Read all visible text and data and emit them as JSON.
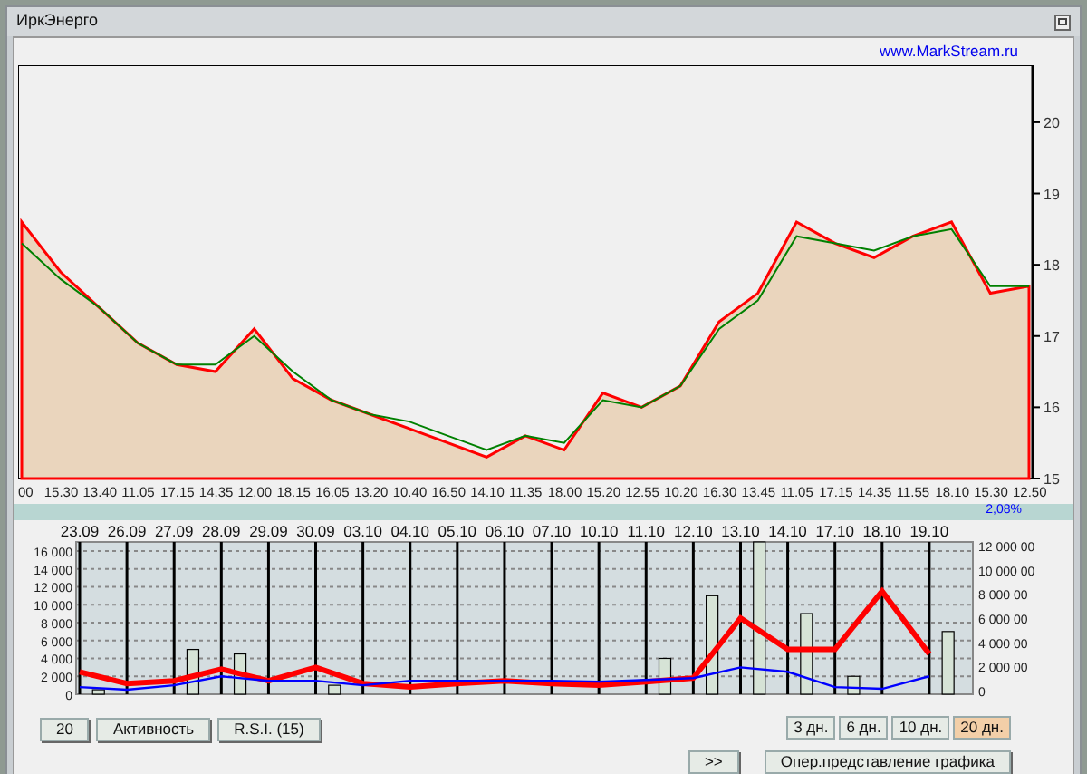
{
  "window": {
    "title": "ИркЭнерго"
  },
  "link": "www.MarkStream.ru",
  "price_chart": {
    "chart_data": {
      "type": "area",
      "categories": [
        "00",
        "15.30",
        "13.40",
        "11.05",
        "17.15",
        "14.35",
        "12.00",
        "18.15",
        "16.05",
        "13.20",
        "10.40",
        "16.50",
        "14.10",
        "11.35",
        "18.00",
        "15.20",
        "12.55",
        "10.20",
        "16.30",
        "13.45",
        "11.05",
        "17.15",
        "14.35",
        "11.55",
        "18.10",
        "15.30",
        "12.50"
      ],
      "ylim": [
        15,
        20.8
      ],
      "yticks": [
        15,
        16,
        17,
        18,
        19,
        20
      ],
      "series": [
        {
          "color": "#ff0000",
          "values": [
            18.6,
            17.9,
            17.4,
            16.9,
            16.6,
            16.5,
            17.1,
            16.4,
            16.1,
            15.9,
            15.7,
            15.5,
            15.3,
            15.6,
            15.4,
            16.2,
            16.0,
            16.3,
            17.2,
            17.6,
            18.6,
            18.3,
            18.1,
            18.4,
            18.6,
            17.6,
            17.7
          ]
        },
        {
          "type": "line",
          "color": "#008000",
          "values": [
            18.3,
            17.8,
            17.4,
            16.9,
            16.6,
            16.6,
            17.0,
            16.5,
            16.1,
            15.9,
            15.8,
            15.6,
            15.4,
            15.6,
            15.5,
            16.1,
            16.0,
            16.3,
            17.1,
            17.5,
            18.4,
            18.3,
            18.2,
            18.4,
            18.5,
            17.7,
            17.7
          ]
        }
      ]
    }
  },
  "change": "2,08%",
  "volume_chart": {
    "chart_data": {
      "type": "line",
      "categories": [
        "23.09",
        "26.09",
        "27.09",
        "28.09",
        "29.09",
        "30.09",
        "03.10",
        "04.10",
        "05.10",
        "06.10",
        "07.10",
        "10.10",
        "11.10",
        "12.10",
        "13.10",
        "14.10",
        "17.10",
        "18.10",
        "19.10"
      ],
      "ylim": [
        0,
        17000
      ],
      "grid": true,
      "yticks": [
        {
          "value": 0,
          "label": "0"
        },
        {
          "value": 2000,
          "label": "2 000"
        },
        {
          "value": 4000,
          "label": "4 000"
        },
        {
          "value": 6000,
          "label": "6 000"
        },
        {
          "value": 8000,
          "label": "8 000"
        },
        {
          "value": 10000,
          "label": "10 000"
        },
        {
          "value": 12000,
          "label": "12 000"
        },
        {
          "value": 14000,
          "label": "14 000"
        },
        {
          "value": 16000,
          "label": "16 000"
        }
      ],
      "series": [
        {
          "color": "#ff0000",
          "values": [
            2500,
            1200,
            1500,
            2800,
            1500,
            3000,
            1200,
            800,
            1200,
            1500,
            1200,
            1000,
            1400,
            1800,
            8500,
            5000,
            5000,
            11500,
            4500
          ]
        },
        {
          "color": "#0000ff",
          "values": [
            800,
            500,
            1000,
            2000,
            1500,
            1500,
            1000,
            1500,
            1500,
            1500,
            1500,
            1400,
            1600,
            1800,
            3000,
            2500,
            800,
            600,
            2000
          ]
        },
        {
          "type": "bar",
          "color": "#d6e3d6",
          "values": [
            500,
            0,
            5000,
            4500,
            0,
            1000,
            0,
            0,
            0,
            0,
            0,
            0,
            4000,
            11000,
            17000,
            9000,
            2000,
            0,
            7000
          ]
        }
      ]
    },
    "right_axis_labels": [
      "12 000 00",
      "10 000 00",
      "8 000 00",
      "6 000 00",
      "4 000 00",
      "2 000 00",
      "0"
    ]
  },
  "left_buttons": [
    {
      "label": "20"
    },
    {
      "label": "Активность"
    },
    {
      "label": "R.S.I. (15)"
    }
  ],
  "period_buttons": [
    {
      "label": "3 дн.",
      "selected": false
    },
    {
      "label": "6 дн.",
      "selected": false
    },
    {
      "label": "10 дн.",
      "selected": false
    },
    {
      "label": "20 дн.",
      "selected": true
    }
  ],
  "next_button": ">>",
  "mode_button": "Опер.представление графика"
}
